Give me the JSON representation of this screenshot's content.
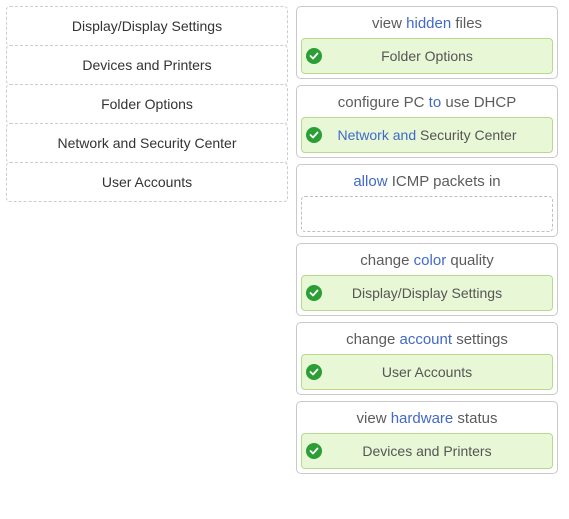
{
  "sources": [
    {
      "label": "Display/Display Settings"
    },
    {
      "label": "Devices and Printers"
    },
    {
      "label": "Folder Options"
    },
    {
      "label": "Network and Security Center"
    },
    {
      "label": "User Accounts"
    }
  ],
  "targets": [
    {
      "title_pre": "view ",
      "title_kw": "hidden",
      "title_post": " files",
      "answer": "Folder Options",
      "filled": true
    },
    {
      "title_pre": "configure PC ",
      "title_kw": "to",
      "title_post": " use DHCP",
      "answer_pre": "Network and ",
      "answer_kw": "",
      "answer_post": "Security Center",
      "answer_multikw": true,
      "answer_kw1": "Network",
      "answer_mid": " and ",
      "filled": true
    },
    {
      "title_pre": "",
      "title_kw": "allow",
      "title_post": " ICMP packets in",
      "answer": "",
      "filled": false
    },
    {
      "title_pre": "change ",
      "title_kw": "color",
      "title_post": " quality",
      "answer": "Display/Display Settings",
      "filled": true
    },
    {
      "title_pre": "change ",
      "title_kw": "account",
      "title_post": " settings",
      "answer": "User Accounts",
      "filled": true
    },
    {
      "title_pre": "view ",
      "title_kw": "hardware",
      "title_post": " status",
      "answer": "Devices and Printers",
      "filled": true
    }
  ]
}
